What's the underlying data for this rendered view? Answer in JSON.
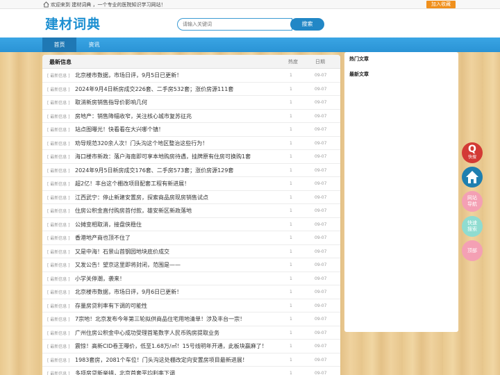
{
  "topbar": {
    "welcome": "欢迎来到 建材词典 ，一个专业的医院知识学习网站！",
    "fav_label": "加入收藏"
  },
  "header": {
    "logo": "建材词典",
    "search_placeholder": "请输入关键词",
    "search_button": "搜索"
  },
  "nav": {
    "items": [
      {
        "label": "首页"
      },
      {
        "label": "资讯"
      }
    ]
  },
  "main": {
    "title": "最新信息",
    "col_hot": "热度",
    "col_date": "日期",
    "rows": [
      {
        "tag": "[ 最新信息 ]",
        "title": "北京楼市数据，市场日评，9月5日已更新！",
        "hot": "1",
        "date": "09-07"
      },
      {
        "tag": "[ 最新信息 ]",
        "title": "2024年9月4日新房成交226套、二手房532套；涨价房源111套",
        "hot": "1",
        "date": "09-07"
      },
      {
        "tag": "[ 最新信息 ]",
        "title": "取消新房销售指导价影响几何",
        "hot": "1",
        "date": "09-07"
      },
      {
        "tag": "[ 最新信息 ]",
        "title": "房地产：销售降幅收窄，关注核心城市复苏征兆",
        "hot": "1",
        "date": "09-07"
      },
      {
        "tag": "[ 最新信息 ]",
        "title": "站点图曝光！快看看在大兴哪个镇！",
        "hot": "1",
        "date": "09-07"
      },
      {
        "tag": "[ 最新信息 ]",
        "title": "劝导规范320余人次！门头沟这个地区整治这些行为！",
        "hot": "1",
        "date": "09-07"
      },
      {
        "tag": "[ 最新信息 ]",
        "title": "海口楼市新政：落户海南即可享本地购房待遇，挂牌原有住房可换购1套",
        "hot": "1",
        "date": "09-07"
      },
      {
        "tag": "[ 最新信息 ]",
        "title": "2024年9月5日新房成交176套、二手房573套；涨价房源129套",
        "hot": "1",
        "date": "09-07"
      },
      {
        "tag": "[ 最新信息 ]",
        "title": "超2亿！丰台这个棚改项目配套工程有新进展！",
        "hot": "1",
        "date": "09-07"
      },
      {
        "tag": "[ 最新信息 ]",
        "title": "江西武宁：停止新建安置房，探索商品房现房销售试点",
        "hot": "1",
        "date": "09-07"
      },
      {
        "tag": "[ 最新信息 ]",
        "title": "住房公积金直付购房首付款，雄安新区新政落地",
        "hot": "1",
        "date": "09-07"
      },
      {
        "tag": "[ 最新信息 ]",
        "title": "公摊变相取消，接盘侠稳住",
        "hot": "1",
        "date": "09-07"
      },
      {
        "tag": "[ 最新信息 ]",
        "title": "香港地产商也顶不住了",
        "hot": "1",
        "date": "09-07"
      },
      {
        "tag": "[ 最新信息 ]",
        "title": "又是中海！石景山首钢园地块底价成交",
        "hot": "1",
        "date": "09-07"
      },
      {
        "tag": "[ 最新信息 ]",
        "title": "又发公告！望京这里即将封闭，范围是——",
        "hot": "1",
        "date": "09-07"
      },
      {
        "tag": "[ 最新信息 ]",
        "title": "小学关停潮，袭来！",
        "hot": "1",
        "date": "09-07"
      },
      {
        "tag": "[ 最新信息 ]",
        "title": "北京楼市数据，市场日评，9月6日已更新！",
        "hot": "1",
        "date": "09-07"
      },
      {
        "tag": "[ 最新信息 ]",
        "title": "存量房贷利率有下调的可能性",
        "hot": "1",
        "date": "09-07"
      },
      {
        "tag": "[ 最新信息 ]",
        "title": "7宗地！北京发布今年第三轮拟供商品住宅用地清单！涉及丰台一宗！",
        "hot": "1",
        "date": "09-07"
      },
      {
        "tag": "[ 最新信息 ]",
        "title": "广州住房公积金中心成功受理首笔数字人民币购房提取业务",
        "hot": "1",
        "date": "09-07"
      },
      {
        "tag": "[ 最新信息 ]",
        "title": "震惊！高新CID卷王曝价，低至1.68万/㎡！15号线明年开通，此板块赢麻了！",
        "hot": "1",
        "date": "09-07"
      },
      {
        "tag": "[ 最新信息 ]",
        "title": "1983套房，2081个车位！门头沟这处棚改定向安置房项目最新进展！",
        "hot": "1",
        "date": "09-07"
      },
      {
        "tag": "[ 最新信息 ]",
        "title": "多项房贷新举措，北京首套平均利率下调",
        "hot": "1",
        "date": "09-07"
      }
    ]
  },
  "side": {
    "hot_title": "热门文章",
    "new_title": "最新文章"
  },
  "float": {
    "search_q": "Q",
    "search_label": "快搜",
    "nav_label": "网站导航",
    "fast_label": "快速搜索",
    "top_label": "顶部"
  },
  "colors": {
    "brand": "#1c8fd1",
    "nav": "#2a93d5",
    "accent": "#f0901c"
  }
}
